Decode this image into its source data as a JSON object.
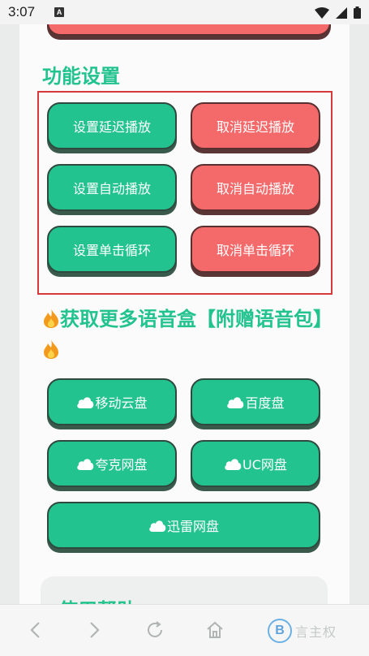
{
  "status_bar": {
    "time": "3:07",
    "notification_icon": "A"
  },
  "settings": {
    "title": "功能设置",
    "buttons": {
      "set_delay": "设置延迟播放",
      "cancel_delay": "取消延迟播放",
      "set_auto": "设置自动播放",
      "cancel_auto": "取消自动播放",
      "set_loop": "设置单击循环",
      "cancel_loop": "取消单击循环"
    }
  },
  "promo": {
    "title_text": "获取更多语音盒【附赠语音包】",
    "downloads": {
      "mobile_cloud": "移动云盘",
      "baidu": "百度盘",
      "quark": "夸克网盘",
      "uc": "UC网盘",
      "xunlei": "迅雷网盘"
    }
  },
  "help": {
    "title": "使用帮助"
  },
  "watermark": {
    "logo": "B",
    "text": "言主权"
  },
  "colors": {
    "accent_green": "#22c38e",
    "accent_red": "#f4696a",
    "box_border_red": "#d63a3a"
  },
  "icons": [
    "signal-icon",
    "wifi-icon",
    "battery-icon",
    "fire-icon",
    "cloud-icon",
    "back-icon",
    "forward-icon",
    "refresh-icon",
    "home-icon"
  ]
}
